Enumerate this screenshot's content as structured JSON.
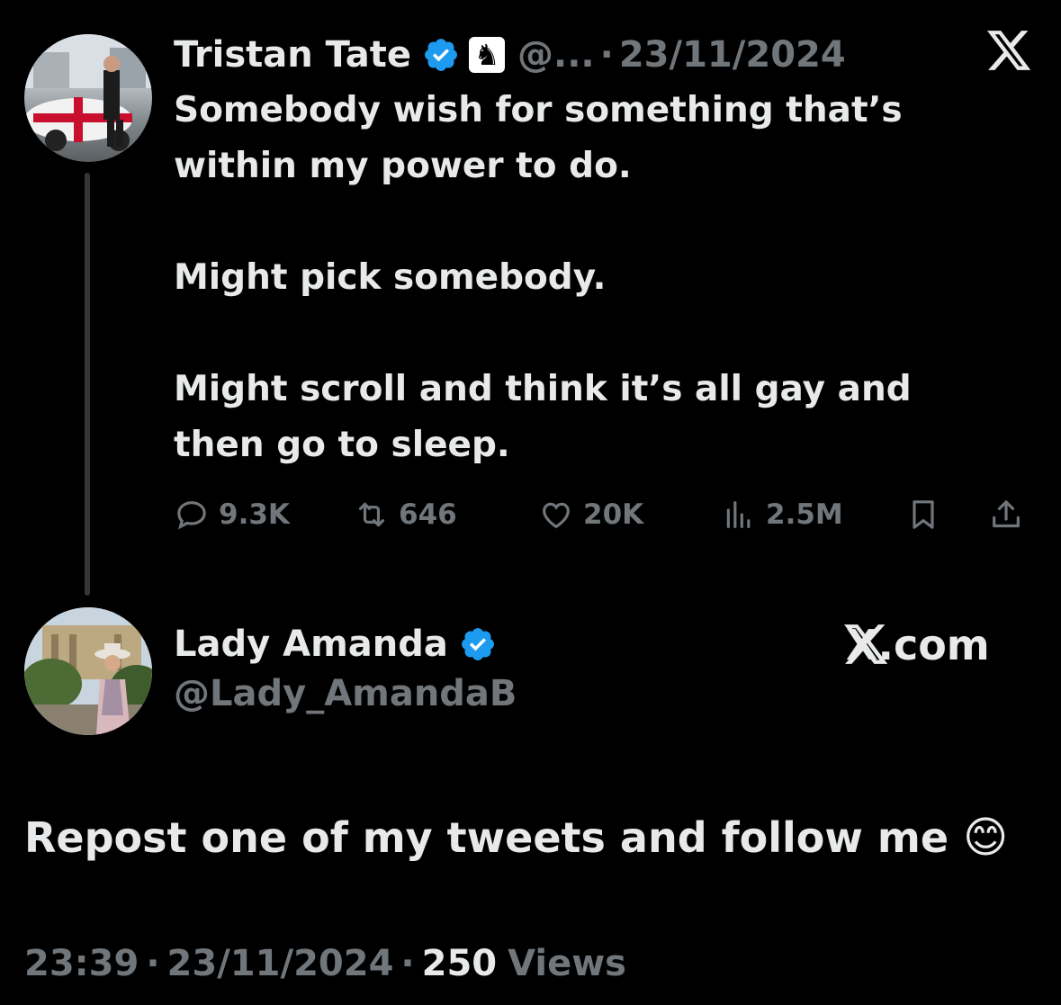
{
  "tweet": {
    "author_name": "Tristan Tate",
    "handle_truncated": "@...",
    "separator": "·",
    "date": "23/11/2024",
    "text": "Somebody wish for something that’s\nwithin my power to do.\n\nMight pick somebody.\n\nMight scroll and think it’s all gay and\nthen go to sleep.",
    "actions": {
      "replies": "9.3K",
      "reposts": "646",
      "likes": "20K",
      "views": "2.5M"
    }
  },
  "reply": {
    "author_name": "Lady Amanda",
    "handle": "@Lady_AmandaB",
    "brand": "X.com",
    "text": "Repost one of my tweets and follow me",
    "emoji": "😊",
    "footer": {
      "time": "23:39",
      "separator": "·",
      "date": "23/11/2024",
      "views_count": "250",
      "views_label": "Views"
    }
  },
  "colors": {
    "background": "#000000",
    "text": "#e7e9ea",
    "muted": "#71767b",
    "verified": "#1d9bf0"
  }
}
